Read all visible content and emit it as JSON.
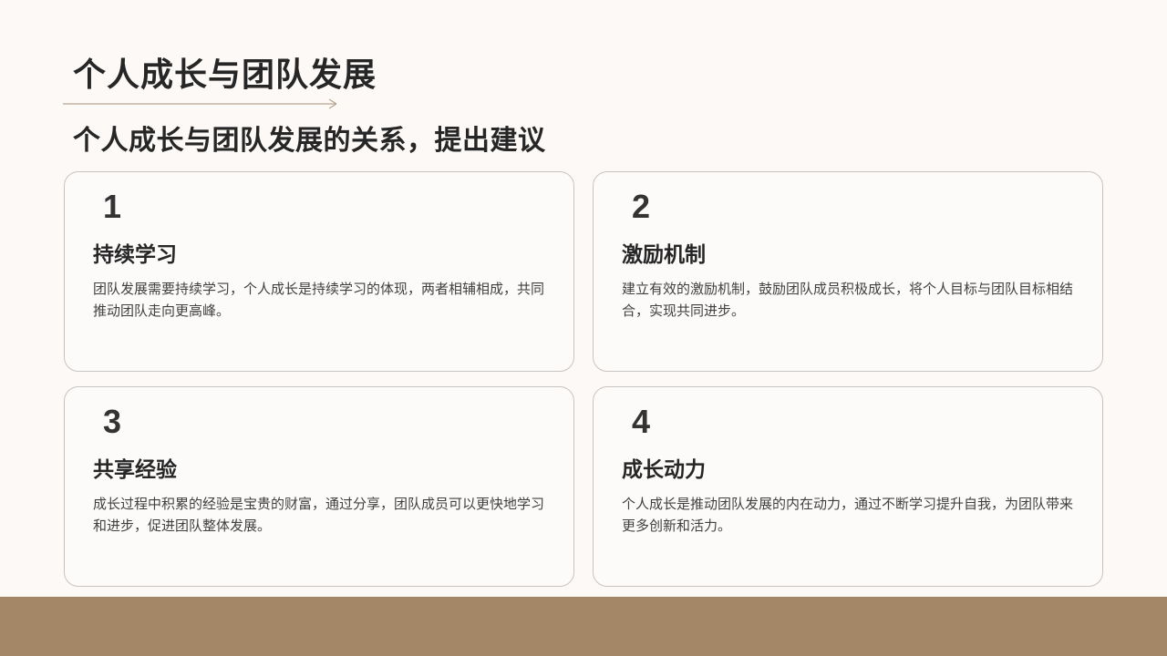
{
  "slide": {
    "title": "个人成长与团队发展",
    "subtitle": "个人成长与团队发展的关系，提出建议",
    "colors": {
      "background": "#fcf9f7",
      "accent_band": "#a38767",
      "rule": "#b8a58f",
      "card_border": "#c9c3bf",
      "text": "#262626"
    },
    "cards": [
      {
        "number": "1",
        "heading": "持续学习",
        "text": "团队发展需要持续学习，个人成长是持续学习的体现，两者相辅相成，共同推动团队走向更高峰。"
      },
      {
        "number": "2",
        "heading": "激励机制",
        "text": "建立有效的激励机制，鼓励团队成员积极成长，将个人目标与团队目标相结合，实现共同进步。"
      },
      {
        "number": "3",
        "heading": "共享经验",
        "text": "成长过程中积累的经验是宝贵的财富，通过分享，团队成员可以更快地学习和进步，促进团队整体发展。"
      },
      {
        "number": "4",
        "heading": "成长动力",
        "text": "个人成长是推动团队发展的内在动力，通过不断学习提升自我，为团队带来更多创新和活力。"
      }
    ]
  }
}
